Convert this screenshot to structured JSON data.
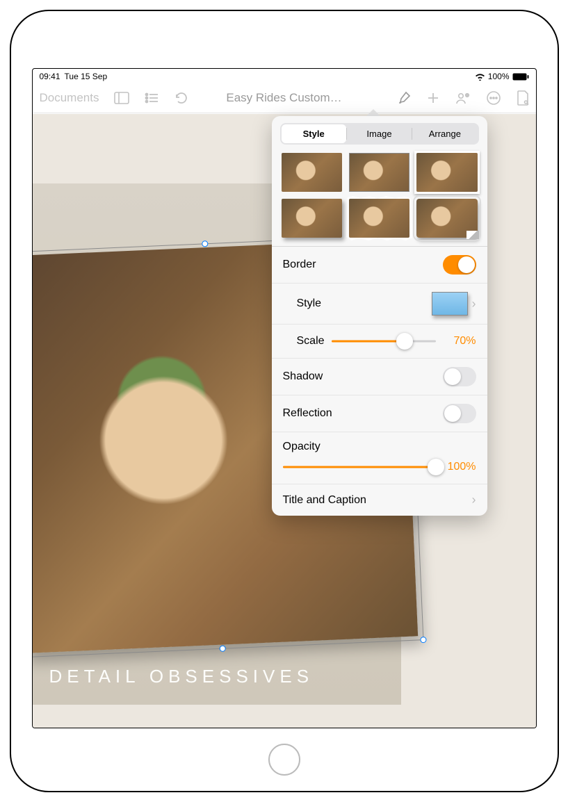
{
  "status": {
    "time": "09:41",
    "date": "Tue 15 Sep",
    "battery_pct": "100%"
  },
  "toolbar": {
    "documents_label": "Documents",
    "title": "Easy Rides Custom…"
  },
  "canvas": {
    "caption": "DETAIL OBSESSIVES"
  },
  "popover": {
    "tabs": {
      "style": "Style",
      "image": "Image",
      "arrange": "Arrange"
    },
    "border_label": "Border",
    "border_on": true,
    "style_label": "Style",
    "scale_label": "Scale",
    "scale_value": "70%",
    "scale_pct": 70,
    "shadow_label": "Shadow",
    "shadow_on": false,
    "reflection_label": "Reflection",
    "reflection_on": false,
    "opacity_label": "Opacity",
    "opacity_value": "100%",
    "opacity_pct": 100,
    "title_caption_label": "Title and Caption"
  }
}
